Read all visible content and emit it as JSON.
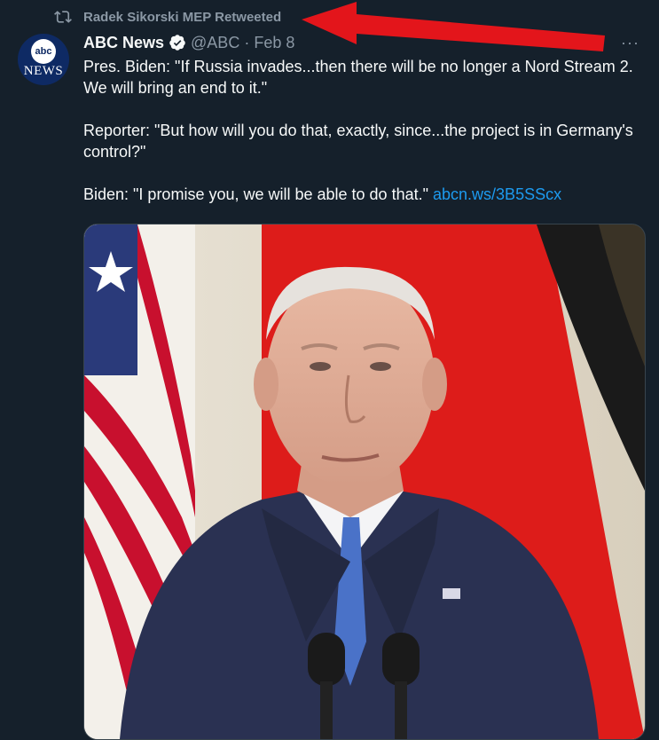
{
  "retweet": {
    "text": "Radek Sikorski MEP Retweeted",
    "icon": "retweet-icon"
  },
  "tweet": {
    "avatar_badge": "abc",
    "avatar_text": "NEWS",
    "author_name": "ABC News",
    "handle": "@ABC",
    "separator": "·",
    "date": "Feb 8",
    "more": "···",
    "paragraphs": [
      "Pres. Biden: \"If Russia invades...then there will be no longer a Nord Stream 2. We will bring an end to it.\"",
      "Reporter: \"But how will you do that, exactly, since...the project is in Germany's control?\""
    ],
    "last_paragraph": "Biden: \"I promise you, we will be able to do that.\"",
    "link": "abcn.ws/3B5SScx"
  },
  "colors": {
    "background": "#15202b",
    "link": "#1d9bf0",
    "muted": "#8b98a5",
    "annotation_arrow": "#e3151b"
  }
}
